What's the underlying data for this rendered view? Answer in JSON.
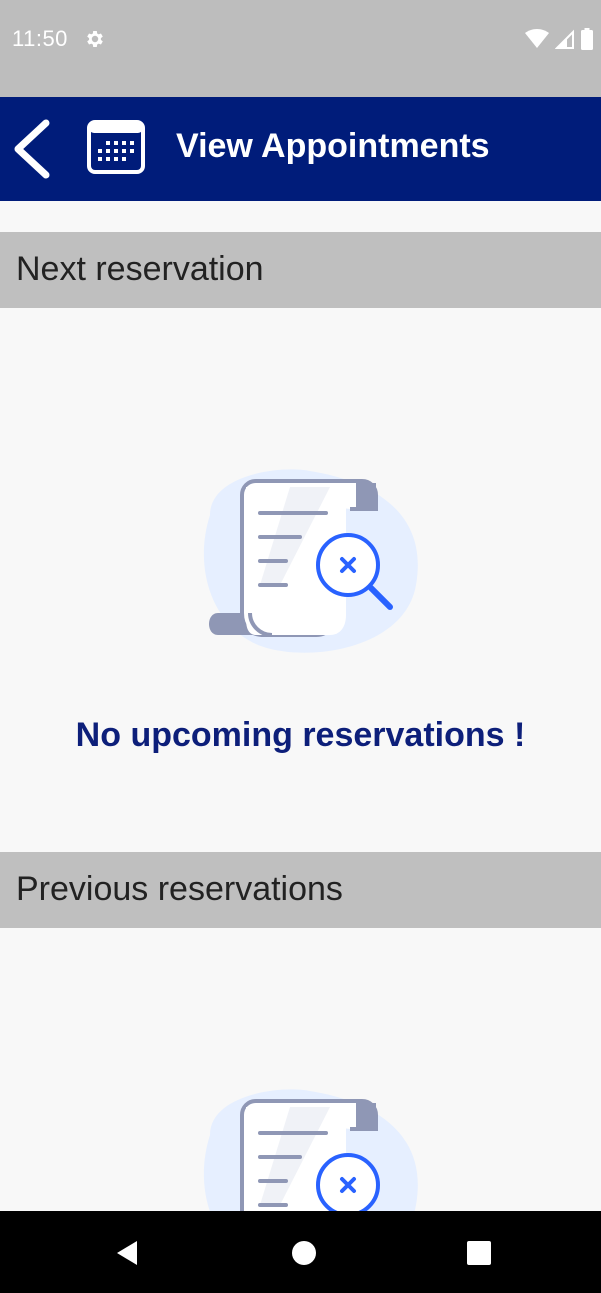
{
  "status_bar": {
    "time": "11:50",
    "icons": [
      "gear-icon",
      "wifi-icon",
      "signal-icon",
      "battery-icon"
    ]
  },
  "app_bar": {
    "title": "View Appointments",
    "back_icon": "back-chevron-icon",
    "calendar_icon": "calendar-icon",
    "background": "#001c7a"
  },
  "sections": {
    "next": {
      "header": "Next reservation",
      "empty_message": "No upcoming reservations !"
    },
    "previous": {
      "header": "Previous reservations"
    }
  },
  "nav_bar": {
    "icons": [
      "nav-back-icon",
      "nav-home-icon",
      "nav-recents-icon"
    ]
  },
  "colors": {
    "accent": "#0d1f7a",
    "section_header_bg": "#bfbfbf",
    "illustration_blue": "#2962ff"
  }
}
